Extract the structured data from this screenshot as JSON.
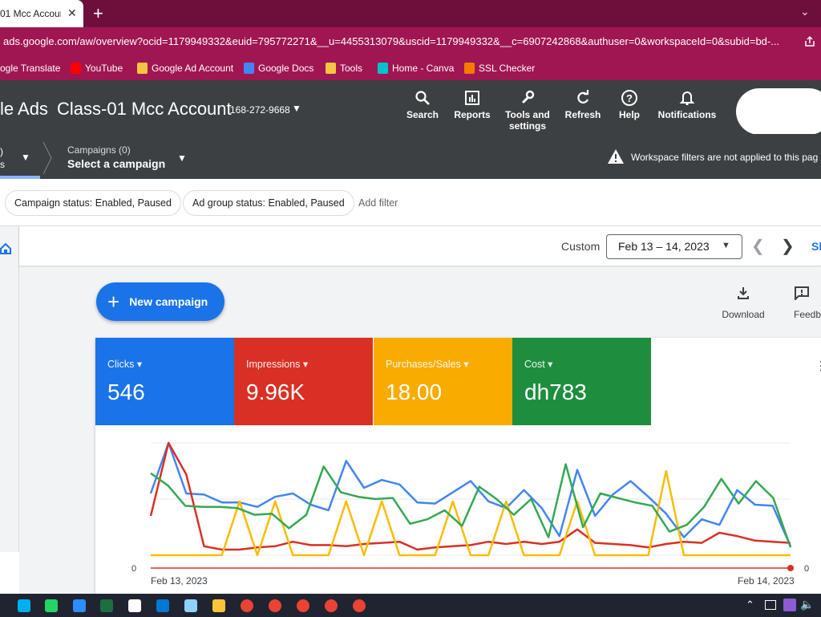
{
  "browser": {
    "tab_title": "01 Mcc Account",
    "url": "ads.google.com/aw/overview?ocid=1179949332&euid=795772271&__u=4455313079&uscid=1179949332&__c=6907242868&authuser=0&workspaceId=0&subid=bd-...",
    "bookmarks": [
      {
        "label": "ogle Translate",
        "icon": "translate-icon",
        "color": "#4285f4"
      },
      {
        "label": "YouTube",
        "icon": "youtube-icon",
        "color": "#ff0000"
      },
      {
        "label": "Google Ad Account",
        "icon": "folder-icon",
        "color": "#f4c542"
      },
      {
        "label": "Google Docs",
        "icon": "docs-icon",
        "color": "#4285f4"
      },
      {
        "label": "Tools",
        "icon": "folder-icon",
        "color": "#f4c542"
      },
      {
        "label": "Home - Canva",
        "icon": "canva-icon",
        "color": "#00c4cc"
      },
      {
        "label": "SSL Checker",
        "icon": "ssl-lock-icon",
        "color": "#f57c00"
      }
    ]
  },
  "header": {
    "brand": "le Ads",
    "account_name": "Class-01 Mcc Account",
    "account_id": "168-272-9668",
    "tools": [
      {
        "label": "Search",
        "icon": "search-icon"
      },
      {
        "label": "Reports",
        "icon": "reports-icon"
      },
      {
        "label": "Tools and\nsettings",
        "icon": "wrench-icon"
      },
      {
        "label": "Refresh",
        "icon": "refresh-icon"
      },
      {
        "label": "Help",
        "icon": "help-icon"
      },
      {
        "label": "Notifications",
        "icon": "bell-icon"
      }
    ]
  },
  "breadcrumb": {
    "left_line1": ")",
    "left_line2": "s",
    "campaigns_label": "Campaigns (0)",
    "campaigns_value": "Select a campaign",
    "warning": "Workspace filters are not applied to this pag"
  },
  "filters": {
    "chips": [
      "Campaign status: Enabled, Paused",
      "Ad group status: Enabled, Paused"
    ],
    "add_filter": "Add filter"
  },
  "date": {
    "label": "Custom",
    "range": "Feb 13 – 14, 2023",
    "show_link": "Sh"
  },
  "actions": {
    "new_campaign": "New campaign",
    "download": "Download",
    "feedback": "Feedb"
  },
  "metrics": [
    {
      "name": "Clicks",
      "value": "546",
      "color": "#1a73e8"
    },
    {
      "name": "Impressions",
      "value": "9.96K",
      "color": "#d93025"
    },
    {
      "name": "Purchases/Sales",
      "value": "18.00",
      "color": "#f9ab00"
    },
    {
      "name": "Cost",
      "value": "dh783",
      "color": "#1e8e3e"
    }
  ],
  "chart_data": {
    "type": "line",
    "x_labels": [
      "Feb 13, 2023",
      "Feb 14, 2023"
    ],
    "y_left_label": "0",
    "y_right_label": "0",
    "series": [
      {
        "name": "Clicks",
        "color": "#4285f4",
        "values": [
          0.55,
          1.0,
          0.55,
          0.54,
          0.47,
          0.47,
          0.43,
          0.52,
          0.55,
          0.45,
          0.4,
          0.84,
          0.6,
          0.67,
          0.63,
          0.47,
          0.46,
          0.56,
          0.66,
          0.48,
          0.42,
          0.58,
          0.42,
          0.17,
          0.76,
          0.35,
          0.54,
          0.66,
          0.52,
          0.37,
          0.16,
          0.32,
          0.27,
          0.58,
          0.45,
          0.44,
          0.08
        ]
      },
      {
        "name": "Impressions",
        "color": "#d93025",
        "values": [
          0.35,
          1.0,
          0.72,
          0.08,
          0.05,
          0.05,
          0.07,
          0.08,
          0.12,
          0.09,
          0.09,
          0.08,
          0.1,
          0.11,
          0.12,
          0.05,
          0.07,
          0.08,
          0.09,
          0.12,
          0.1,
          0.12,
          0.1,
          0.12,
          0.23,
          0.11,
          0.1,
          0.09,
          0.07,
          0.1,
          0.12,
          0.11,
          0.2,
          0.17,
          0.13,
          0.12,
          0.11
        ]
      },
      {
        "name": "Purchases/Sales",
        "color": "#fbbc04",
        "values": [
          0.0,
          0.0,
          0.0,
          0.0,
          0.0,
          0.48,
          0.0,
          0.48,
          0.0,
          0.0,
          0.0,
          0.48,
          0.0,
          0.48,
          0.0,
          0.0,
          0.0,
          0.48,
          0.0,
          0.0,
          0.48,
          0.0,
          0.0,
          0.0,
          0.48,
          0.0,
          0.0,
          0.0,
          0.0,
          0.75,
          0.0,
          0.0,
          0.0,
          0.0,
          0.0,
          0.0,
          0.0
        ]
      },
      {
        "name": "Cost",
        "color": "#34a853",
        "values": [
          0.73,
          0.62,
          0.44,
          0.43,
          0.43,
          0.42,
          0.36,
          0.37,
          0.24,
          0.36,
          0.79,
          0.56,
          0.52,
          0.5,
          0.51,
          0.28,
          0.32,
          0.4,
          0.26,
          0.61,
          0.5,
          0.36,
          0.5,
          0.16,
          0.81,
          0.25,
          0.55,
          0.51,
          0.47,
          0.44,
          0.21,
          0.27,
          0.43,
          0.68,
          0.46,
          0.66,
          0.51,
          0.07
        ]
      }
    ],
    "grid": true,
    "legend": "metric cards above chart"
  },
  "taskbar": {
    "icons": [
      "skype-icon",
      "whatsapp-icon",
      "zoom-icon",
      "excel-icon",
      "generic-app-icon",
      "vscode-icon",
      "notepad-icon",
      "file-explorer-icon",
      "chrome-icon",
      "chrome-icon",
      "chrome-icon",
      "chrome-icon",
      "chrome-icon"
    ]
  }
}
